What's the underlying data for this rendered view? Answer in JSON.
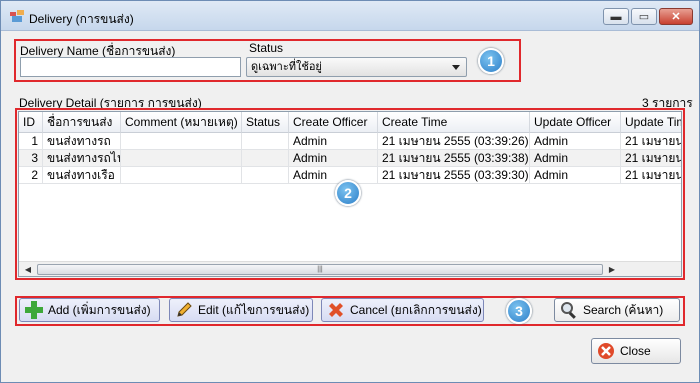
{
  "window": {
    "title": "Delivery (การขนส่ง)"
  },
  "filters": {
    "name_label": "Delivery Name (ชื่อการขนส่ง)",
    "name_value": "",
    "status_label": "Status",
    "status_value": "ดูเฉพาะที่ใช้อยู่"
  },
  "detail": {
    "label": "Delivery Detail (รายการ การขนส่ง)",
    "count": "3 รายการ"
  },
  "badges": [
    "1",
    "2",
    "3"
  ],
  "grid": {
    "columns": [
      "ID",
      "ชื่อการขนส่ง",
      "Comment  (หมายเหตุ)",
      "Status",
      "Create Officer",
      "Create Time",
      "Update Officer",
      "Update Time"
    ],
    "rows": [
      [
        "1",
        "ขนส่งทางรถ",
        "",
        "",
        "Admin",
        "21 เมษายน 2555  (03:39:26)",
        "Admin",
        "21 เมษายน"
      ],
      [
        "3",
        "ขนส่งทางรถไฟ",
        "",
        "",
        "Admin",
        "21 เมษายน 2555  (03:39:38)",
        "Admin",
        "21 เมษายน"
      ],
      [
        "2",
        "ขนส่งทางเรือ",
        "",
        "",
        "Admin",
        "21 เมษายน 2555  (03:39:30)",
        "Admin",
        "21 เมษายน"
      ]
    ]
  },
  "buttons": {
    "add": "Add (เพิ่มการขนส่ง)",
    "edit": "Edit (แก้ไขการขนส่ง)",
    "cancel": "Cancel (ยกเลิกการขนส่ง)",
    "search": "Search (ค้นหา)",
    "close": "Close"
  },
  "colors": {
    "highlight_border": "#e0282c",
    "badge": "#2d7fc8"
  }
}
